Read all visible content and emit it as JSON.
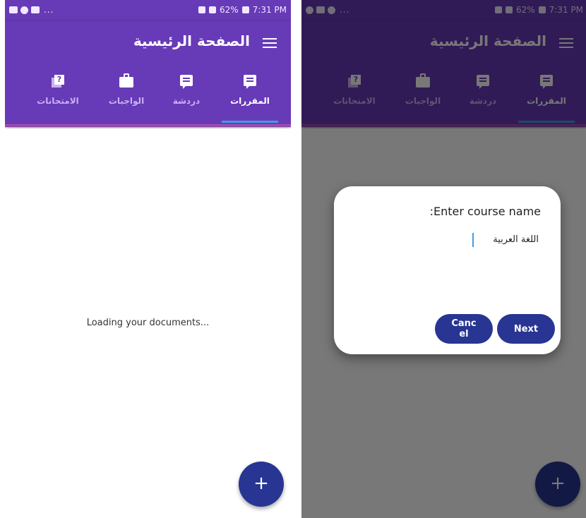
{
  "statusbar": {
    "dots": "...",
    "battery": "62%",
    "time": "7:31 PM"
  },
  "toolbar": {
    "title": "الصفحة الرئيسية"
  },
  "tabs": [
    {
      "label": "المقررات",
      "icon": "chat-bubble-icon",
      "active": true
    },
    {
      "label": "دردشة",
      "icon": "chat-icon",
      "active": false
    },
    {
      "label": "الواجبات",
      "icon": "briefcase-icon",
      "active": false
    },
    {
      "label": "الامتحانات",
      "icon": "quiz-icon",
      "active": false
    }
  ],
  "main": {
    "loading_text": "Loading your documents..."
  },
  "fab": {
    "label": "+"
  },
  "dialog": {
    "title": ":Enter course name",
    "input_value": "اللغة العربية",
    "next_label": "Next",
    "cancel_label": "Canc\nel"
  },
  "colors": {
    "primary": "#673AB7",
    "accent": "#283593",
    "tab_indicator": "#3E9CEB"
  }
}
